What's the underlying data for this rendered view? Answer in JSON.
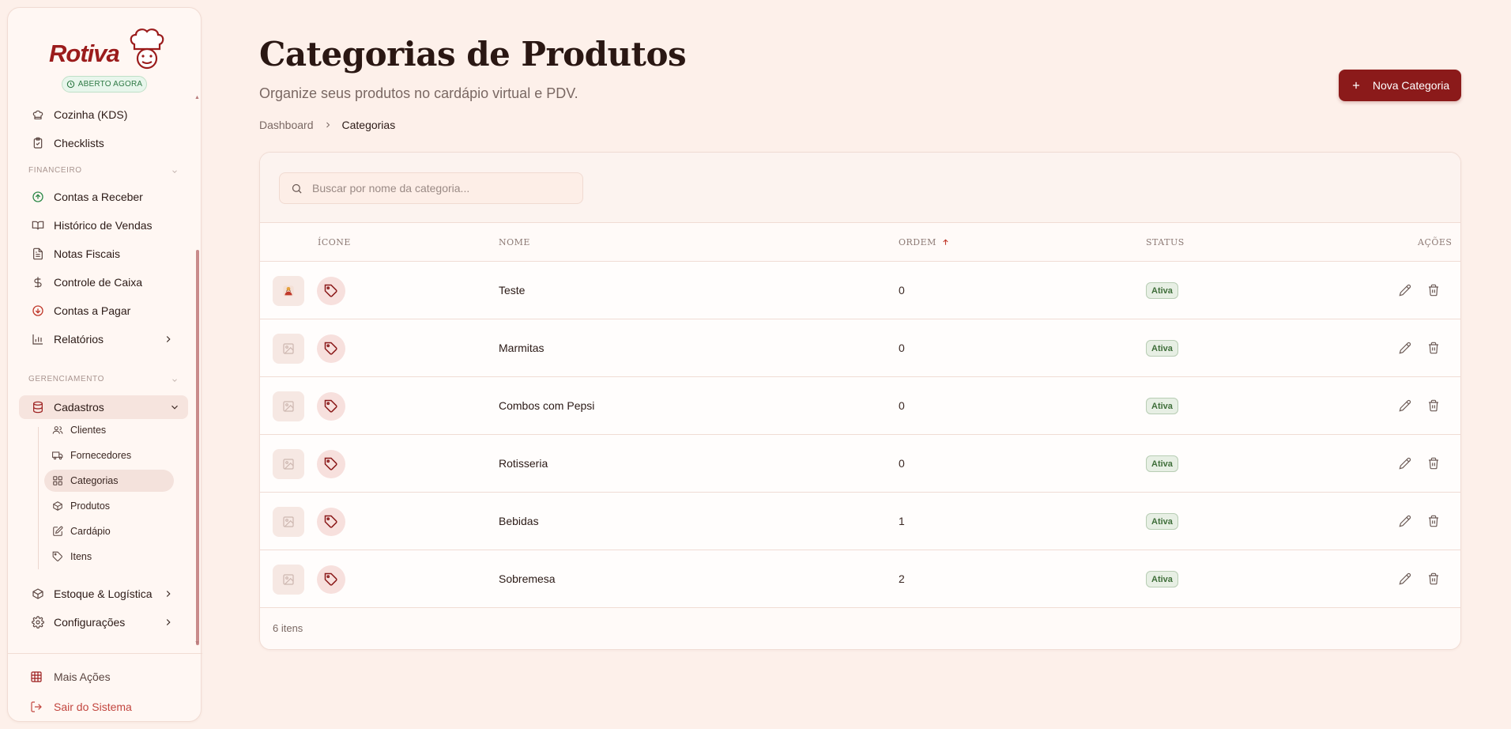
{
  "brand": {
    "name": "Rotiva",
    "status": "ABERTO AGORA",
    "accent": "#8b1a1a"
  },
  "sidebar": {
    "top_items": [
      {
        "label": "Cozinha (KDS)",
        "icon": "chef-hat-icon"
      },
      {
        "label": "Checklists",
        "icon": "clipboard-check-icon"
      }
    ],
    "financeiro": {
      "title": "FINANCEIRO",
      "items": [
        {
          "label": "Contas a Receber",
          "icon": "arrow-up-circle-icon"
        },
        {
          "label": "Histórico de Vendas",
          "icon": "book-open-icon"
        },
        {
          "label": "Notas Fiscais",
          "icon": "file-text-icon"
        },
        {
          "label": "Controle de Caixa",
          "icon": "dollar-sign-icon"
        },
        {
          "label": "Contas a Pagar",
          "icon": "arrow-down-circle-icon"
        },
        {
          "label": "Relatórios",
          "icon": "bar-chart-icon"
        }
      ]
    },
    "gerenciamento": {
      "title": "GERENCIAMENTO",
      "cadastros": "Cadastros",
      "sub_items": [
        {
          "label": "Clientes",
          "icon": "users-icon"
        },
        {
          "label": "Fornecedores",
          "icon": "truck-icon"
        },
        {
          "label": "Categorias",
          "icon": "grid-icon"
        },
        {
          "label": "Produtos",
          "icon": "package-icon"
        },
        {
          "label": "Cardápio",
          "icon": "edit-square-icon"
        },
        {
          "label": "Itens",
          "icon": "tag-icon"
        }
      ],
      "estoque": "Estoque & Logística",
      "config": "Configurações"
    },
    "footer": {
      "more": "Mais Ações",
      "logout": "Sair do Sistema"
    }
  },
  "header": {
    "title": "Categorias de Produtos",
    "subtitle": "Organize seus produtos no cardápio virtual e PDV.",
    "breadcrumb": [
      "Dashboard",
      "Categorias"
    ],
    "new_button": "Nova Categoria"
  },
  "search": {
    "placeholder": "Buscar por nome da categoria..."
  },
  "table": {
    "columns": [
      "ÍCONE",
      "NOME",
      "ORDEM",
      "STATUS",
      "AÇÕES"
    ],
    "rows": [
      {
        "name": "Teste",
        "order": "0",
        "status": "Ativa",
        "has_image": true
      },
      {
        "name": "Marmitas",
        "order": "0",
        "status": "Ativa",
        "has_image": false
      },
      {
        "name": "Combos com Pepsi",
        "order": "0",
        "status": "Ativa",
        "has_image": false
      },
      {
        "name": "Rotisseria",
        "order": "0",
        "status": "Ativa",
        "has_image": false
      },
      {
        "name": "Bebidas",
        "order": "1",
        "status": "Ativa",
        "has_image": false
      },
      {
        "name": "Sobremesa",
        "order": "2",
        "status": "Ativa",
        "has_image": false
      }
    ],
    "footer": "6 itens"
  }
}
